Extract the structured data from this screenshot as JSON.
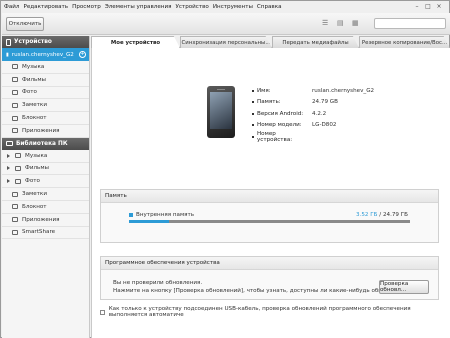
{
  "menu": [
    "Файл",
    "Редактировать",
    "Просмотр",
    "Элементы управления",
    "Устройство",
    "Инструменты",
    "Справка"
  ],
  "toolbar": {
    "disconnect_label": "Отключить",
    "search_placeholder": ""
  },
  "sidebar": {
    "device_section": "Устройство",
    "device_name": "ruslan.chernyshev_G2",
    "device_items": [
      "Музыка",
      "Фильмы",
      "Фото",
      "Заметки",
      "Блокнот",
      "Приложения"
    ],
    "library_section": "Библиотека ПК",
    "library_items": [
      "Музыка",
      "Фильмы",
      "Фото",
      "Заметки",
      "Блокнот",
      "Приложения",
      "SmartShare"
    ]
  },
  "tabs": [
    "Мое устройство",
    "Синхронизация персональны...",
    "Передать медиафайлы",
    "Резервное копирование/Вос..."
  ],
  "device_info": {
    "name_label": "Имя:",
    "name_value": "ruslan.chernyshev_G2",
    "memory_label": "Память:",
    "memory_value": "24.79 GB",
    "android_label": "Версия Android:",
    "android_value": "4.2.2",
    "model_label": "Номер модели:",
    "model_value": "LG-D802",
    "device_no_label": "Номер устройства:",
    "device_no_value": ""
  },
  "memory": {
    "title": "Память",
    "internal_label": "Внутренняя память",
    "used": "3.52 ГБ",
    "total": " / 24.79 ГБ",
    "used_fraction": 0.142
  },
  "software": {
    "title": "Программное обеспечения устройства",
    "line1": "Вы не проверили обновления.",
    "line2": "Нажмите на кнопку [Проверка обновлений], чтобы узнать, доступны ли какие-нибудь обновления.",
    "check_label": "Проверка обновл..."
  },
  "footer_check_label": "Как только к устройству подсоединен USB-кабель, проверка обновлений программного обеспечения выполняется автоматиче",
  "colors": {
    "accent": "#2d9bd6"
  }
}
